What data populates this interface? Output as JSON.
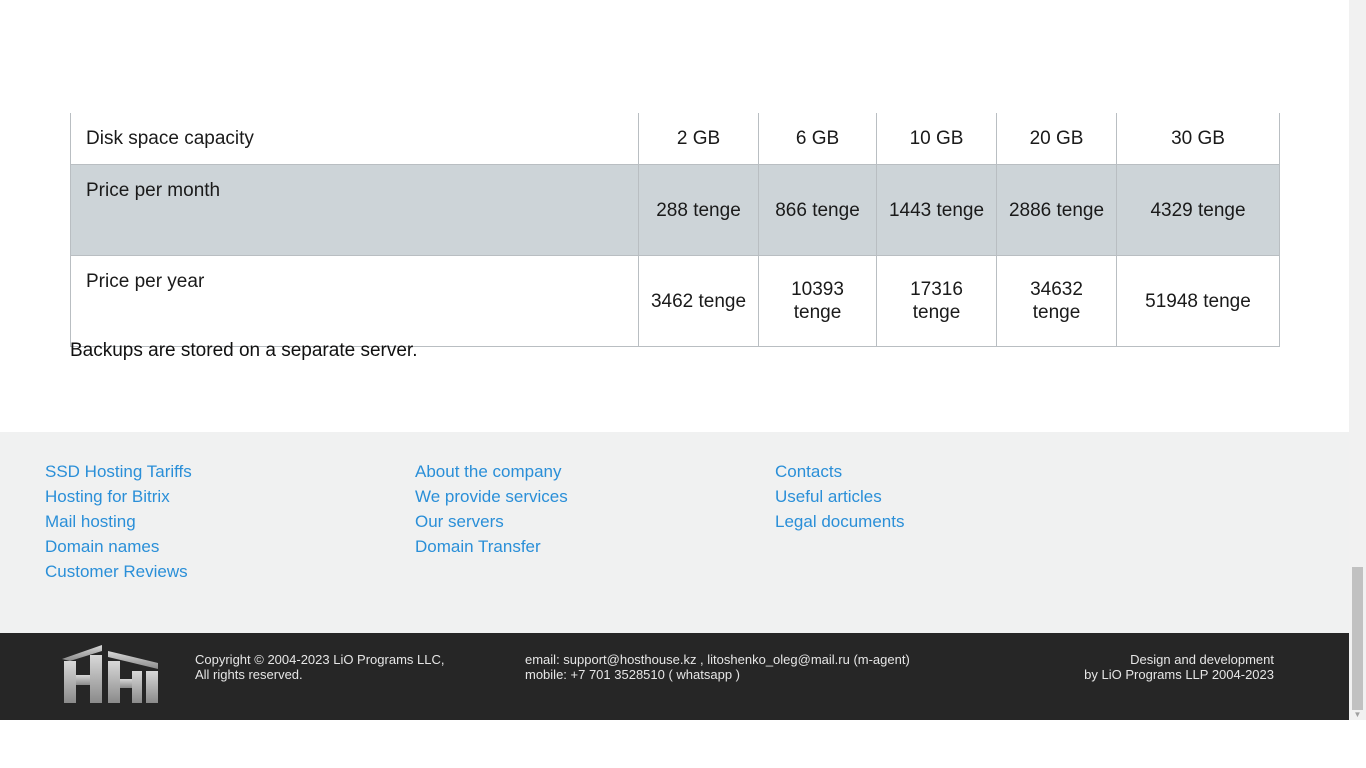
{
  "table": {
    "rows": [
      {
        "label": "Disk space capacity",
        "values": [
          "2 GB",
          "6 GB",
          "10 GB",
          "20 GB",
          "30 GB"
        ]
      },
      {
        "label": "Price per month",
        "values": [
          "288 tenge",
          "866 tenge",
          "1443 tenge",
          "2886 tenge",
          "4329 tenge"
        ]
      },
      {
        "label": "Price per year",
        "values": [
          "3462 tenge",
          "10393 tenge",
          "17316 tenge",
          "34632 tenge",
          "51948 tenge"
        ]
      }
    ]
  },
  "note": "Backups are stored on a separate server.",
  "footer": {
    "col1": [
      "SSD Hosting Tariffs",
      "Hosting for Bitrix",
      "Mail hosting",
      "Domain names",
      "Customer Reviews"
    ],
    "col2": [
      "About the company",
      "We provide services",
      "Our servers",
      "Domain Transfer"
    ],
    "col3": [
      "Contacts",
      "Useful articles",
      "Legal documents"
    ]
  },
  "bottom": {
    "copyright_line1": "Copyright © 2004-2023 LiO Programs LLC,",
    "copyright_line2": "All rights reserved.",
    "email_line": "email: support@hosthouse.kz , litoshenko_oleg@mail.ru (m-agent)",
    "mobile_line": "mobile: +7 701 3528510 ( whatsapp )",
    "dev_line1": "Design and development",
    "dev_line2": "by LiO Programs LLP 2004-2023"
  },
  "colors": {
    "link": "#2a8fd8",
    "highlight_row": "#cdd4d8",
    "footer_bg": "#f0f1f1",
    "bottom_bg": "#262626"
  },
  "icons": {
    "logo": "hosthouse-logo",
    "scroll_down": "scroll-down-arrow-icon"
  }
}
